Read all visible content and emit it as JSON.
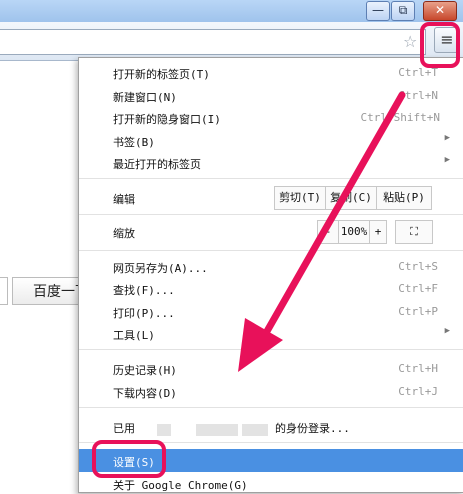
{
  "window": {
    "min": "—",
    "max": "⧉",
    "close": "✕"
  },
  "toolbar": {
    "star": "☆",
    "menu_icon": "≡"
  },
  "page": {
    "search_button": "百度一下"
  },
  "menu": {
    "new_tab": {
      "label": "打开新的标签页(T)",
      "shortcut": "Ctrl+T"
    },
    "new_window": {
      "label": "新建窗口(N)",
      "shortcut": "Ctrl+N"
    },
    "incognito": {
      "label": "打开新的隐身窗口(I)",
      "shortcut": "Ctrl+Shift+N"
    },
    "bookmarks": {
      "label": "书签(B)"
    },
    "recent_tabs": {
      "label": "最近打开的标签页"
    },
    "edit": {
      "label": "编辑",
      "cut": "剪切(T)",
      "copy": "复制(C)",
      "paste": "粘贴(P)"
    },
    "zoom": {
      "label": "缩放",
      "minus": "-",
      "value": "100%",
      "plus": "+",
      "fullscreen": "⛶"
    },
    "save_as": {
      "label": "网页另存为(A)...",
      "shortcut": "Ctrl+S"
    },
    "find": {
      "label": "查找(F)...",
      "shortcut": "Ctrl+F"
    },
    "print": {
      "label": "打印(P)...",
      "shortcut": "Ctrl+P"
    },
    "tools": {
      "label": "工具(L)"
    },
    "history": {
      "label": "历史记录(H)",
      "shortcut": "Ctrl+H"
    },
    "downloads": {
      "label": "下载内容(D)",
      "shortcut": "Ctrl+J"
    },
    "signed_in": {
      "prefix": "已用",
      "suffix": "的身份登录..."
    },
    "settings": {
      "label": "设置(S)"
    },
    "about": {
      "label": "关于 Google Chrome(G)"
    }
  },
  "annotation": {
    "color": "#e8115a"
  }
}
